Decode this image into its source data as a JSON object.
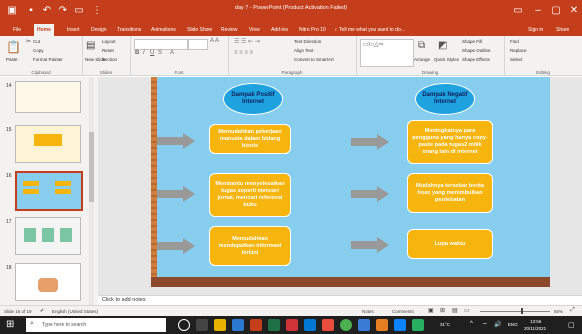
{
  "window": {
    "title": "day 7 - PowerPoint (Product Activation Failed)",
    "buttons": {
      "minimize": "–",
      "maximize": "▢",
      "close": "✕"
    }
  },
  "tabs": [
    "File",
    "Home",
    "Insert",
    "Design",
    "Transitions",
    "Animations",
    "Slide Show",
    "Review",
    "View",
    "Add-ins",
    "Nitro Pro 10"
  ],
  "tellme": "♀ Tell me what you want to do...",
  "account": {
    "signin": "Sign in",
    "share": "Share"
  },
  "ribbon": {
    "clipboard": {
      "paste": "Paste",
      "cut": "Cut",
      "copy": "Copy",
      "format_painter": "Format Painter",
      "label": "Clipboard"
    },
    "slides": {
      "new_slide": "New Slide",
      "layout": "Layout",
      "reset": "Reset",
      "section": "Section",
      "label": "Slides"
    },
    "font": {
      "label": "Font"
    },
    "paragraph": {
      "text_direction": "Text Direction",
      "align_text": "Align Text",
      "smartart": "Convert to SmartArt",
      "label": "Paragraph"
    },
    "drawing": {
      "arrange": "Arrange",
      "quick_styles": "Quick Styles",
      "shape_fill": "Shape Fill",
      "shape_outline": "Shape Outline",
      "shape_effects": "Shape Effects",
      "label": "Drawing"
    },
    "editing": {
      "find": "Find",
      "replace": "Replace",
      "select": "Select",
      "label": "Editing"
    }
  },
  "slides_panel": {
    "numbers": [
      "14",
      "15",
      "16",
      "17",
      "18"
    ]
  },
  "slide": {
    "header_left": "Dampak Positif Internet",
    "header_right": "Dampak Negatif Internet",
    "left_boxes": [
      "Memudahkan pekerjaan manusia dalam bidang bisnis",
      "Membantu menyelesaikan tugas seperti mencari jurnal, mencari referensi buku",
      "Memudahkan mendapatkan informasi terkini"
    ],
    "right_boxes": [
      "Meningkatnya para pengguna yang hanya copy-paste pada tugas2 milik orang lain di internet",
      "Mudahnya tersebar berita hoax yang menimbulkan perdebatan",
      "Lupa waktu"
    ]
  },
  "notes": "Click to add notes",
  "status": {
    "slide_info": "Slide 16 of 19",
    "language": "English (United States)",
    "notes": "Notes",
    "comments": "Comments",
    "zoom": "65%"
  },
  "taskbar": {
    "search": "Type here to search",
    "temp": "31°C",
    "lang": "ENG",
    "time": "13:56",
    "date": "20/11/2021"
  },
  "colors": {
    "accent": "#c43e1c",
    "slide_bg": "#87cdee",
    "box": "#f5b50c",
    "oval": "#1fa3e0"
  }
}
